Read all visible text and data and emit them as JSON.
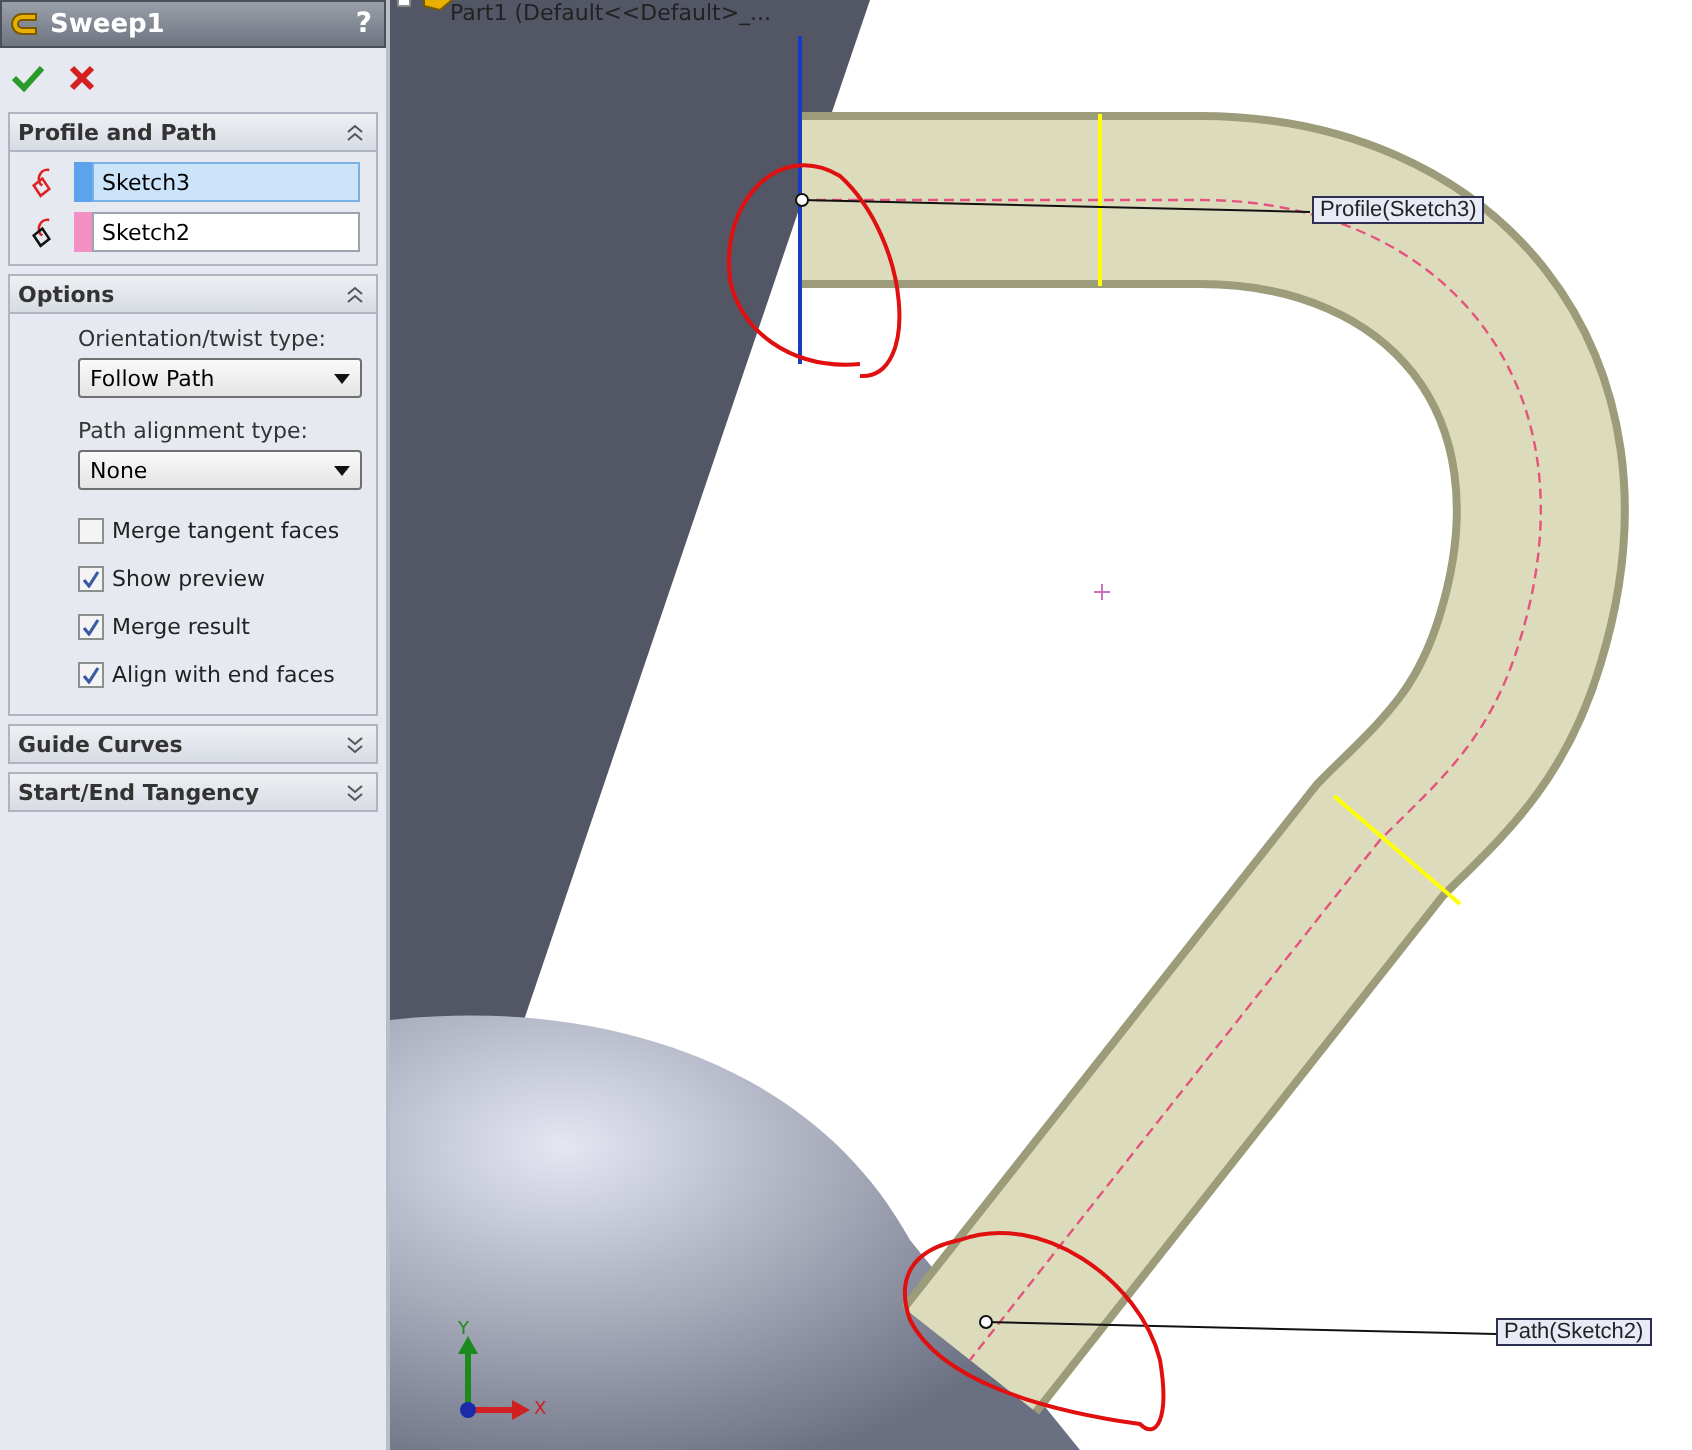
{
  "property_manager": {
    "title": "Sweep1",
    "help": "?"
  },
  "profile_and_path": {
    "title": "Profile and Path",
    "expanded": true,
    "fields": [
      {
        "kind": "profile",
        "value": "Sketch3",
        "color": "#5ba3ea",
        "selected": true
      },
      {
        "kind": "path",
        "value": "Sketch2",
        "color": "#f28fc4",
        "selected": false
      }
    ]
  },
  "options": {
    "title": "Options",
    "expanded": true,
    "dropdowns": [
      {
        "label": "Orientation/twist type:",
        "value": "Follow Path"
      },
      {
        "label": "Path alignment type:",
        "value": "None"
      }
    ],
    "checkboxes": [
      {
        "label": "Merge tangent faces",
        "checked": false
      },
      {
        "label": "Show preview",
        "checked": true
      },
      {
        "label": "Merge result",
        "checked": true
      },
      {
        "label": "Align with end faces",
        "checked": true
      }
    ]
  },
  "collapsed_sections": [
    {
      "title": "Guide Curves",
      "expanded": false
    },
    {
      "title": "Start/End Tangency",
      "expanded": false
    }
  ],
  "viewport": {
    "tree_item": "Part1  (Default<<Default>_...",
    "callouts": [
      {
        "kind": "profile",
        "label": "Profile(Sketch3)"
      },
      {
        "kind": "path",
        "label": "Path(Sketch2)"
      }
    ],
    "axis_labels": [
      "Y",
      "X"
    ]
  }
}
